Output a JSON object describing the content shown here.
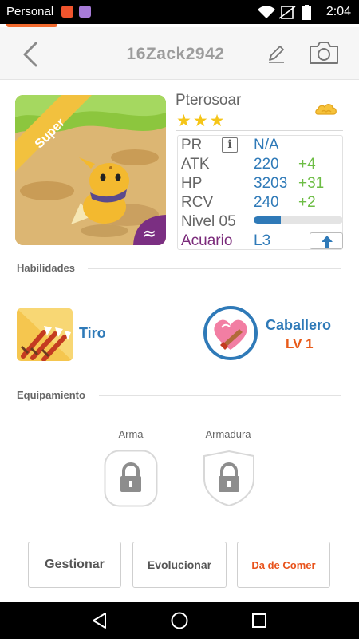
{
  "status_bar": {
    "carrier": "Personal",
    "time": "2:04"
  },
  "header": {
    "title": "16Zack2942",
    "back_icon": "chevron-left-icon",
    "edit_icon": "pencil-icon",
    "camera_icon": "camera-icon"
  },
  "monster": {
    "name": "Pterosoar",
    "rarity_label": "Super",
    "star_count": 3,
    "stars": "★★★",
    "element_icon": "cloud-icon",
    "class_symbol": "≈"
  },
  "stats": {
    "pr": {
      "label": "PR",
      "value": "N/A"
    },
    "atk": {
      "label": "ATK",
      "value": "220",
      "bonus": "+4"
    },
    "hp": {
      "label": "HP",
      "value": "3203",
      "bonus": "+31"
    },
    "rcv": {
      "label": "RCV",
      "value": "240",
      "bonus": "+2"
    },
    "level": {
      "label": "Nivel 05",
      "progress": 0.3
    },
    "aquarium": {
      "label": "Acuario",
      "value": "L3"
    }
  },
  "skills": {
    "section_title": "Habilidades",
    "active": {
      "name": "Tiro"
    },
    "passive": {
      "name": "Caballero",
      "level": "LV 1"
    }
  },
  "equipment": {
    "section_title": "Equipamiento",
    "weapon_label": "Arma",
    "armor_label": "Armadura"
  },
  "actions": {
    "manage": "Gestionar",
    "evolve": "Evolucionar",
    "feed": "Da de Comer"
  },
  "colors": {
    "accent_blue": "#2f7ab8",
    "bonus_green": "#6dbd45",
    "accent_orange": "#e8531c",
    "aquarium_purple": "#7a2a7a",
    "star_gold": "#f5c518"
  }
}
